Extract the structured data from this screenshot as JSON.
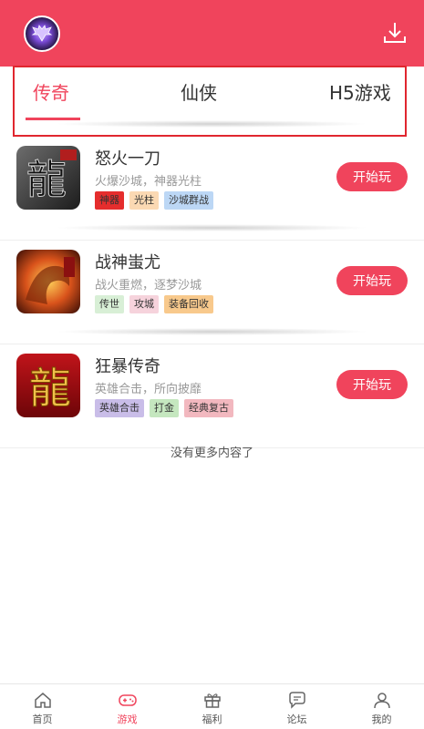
{
  "header": {
    "avatar_icon": "bat-logo-icon",
    "download_icon": "download-icon",
    "accent_color": "#f0445c"
  },
  "tabs": [
    {
      "label": "传奇",
      "active": true
    },
    {
      "label": "仙侠",
      "active": false
    },
    {
      "label": "H5游戏",
      "active": false
    }
  ],
  "games": [
    {
      "title": "怒火一刀",
      "desc": "火爆沙城，神器光柱",
      "tags": [
        {
          "label": "神器",
          "color": "#e52d2d"
        },
        {
          "label": "光柱",
          "color": "#fbd9b3"
        },
        {
          "label": "沙城群战",
          "color": "#bcd7f5"
        }
      ],
      "button": "开始玩"
    },
    {
      "title": "战神蚩尤",
      "desc": "战火重燃，逐梦沙城",
      "tags": [
        {
          "label": "传世",
          "color": "#d8efd6"
        },
        {
          "label": "攻城",
          "color": "#f6d3dc"
        },
        {
          "label": "装备回收",
          "color": "#f8c98c"
        }
      ],
      "button": "开始玩"
    },
    {
      "title": "狂暴传奇",
      "desc": "英雄合击，所向披靡",
      "tags": [
        {
          "label": "英雄合击",
          "color": "#c9bde8"
        },
        {
          "label": "打金",
          "color": "#c5e7bf"
        },
        {
          "label": "经典复古",
          "color": "#f2b8bf"
        }
      ],
      "button": "开始玩"
    }
  ],
  "footer_text": "没有更多内容了",
  "bottom_nav": [
    {
      "label": "首页",
      "icon": "home-icon",
      "active": false
    },
    {
      "label": "游戏",
      "icon": "gamepad-icon",
      "active": true
    },
    {
      "label": "福利",
      "icon": "gift-icon",
      "active": false
    },
    {
      "label": "论坛",
      "icon": "chat-icon",
      "active": false
    },
    {
      "label": "我的",
      "icon": "user-icon",
      "active": false
    }
  ]
}
